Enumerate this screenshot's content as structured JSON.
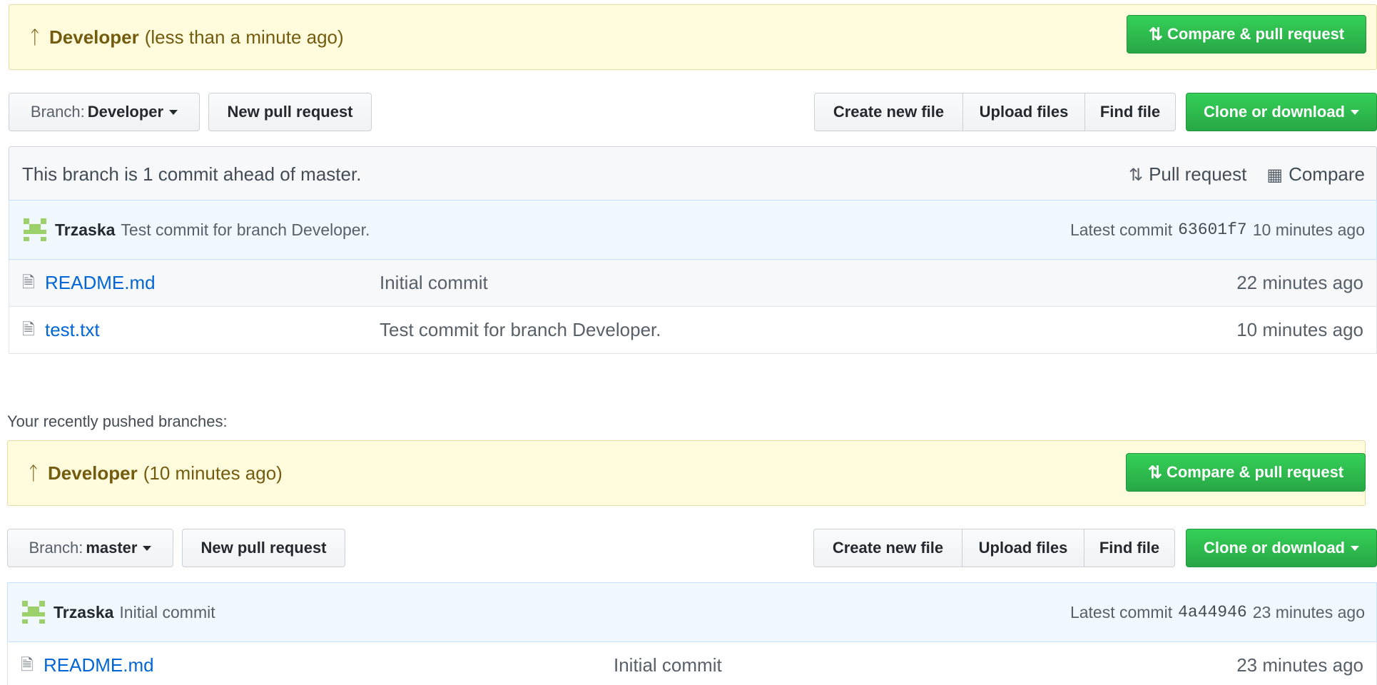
{
  "top": {
    "banner": {
      "branch": "Developer",
      "time": "(less than a minute ago)",
      "compare_button": "Compare & pull request"
    },
    "toolbar": {
      "branch_prefix": "Branch:",
      "branch_name": "Developer",
      "new_pr": "New pull request",
      "create_file": "Create new file",
      "upload_files": "Upload files",
      "find_file": "Find file",
      "clone": "Clone or download"
    },
    "summary": {
      "text": "This branch is 1 commit ahead of master.",
      "pull_request": "Pull request",
      "compare": "Compare"
    },
    "commit": {
      "author": "Trzaska",
      "message": "Test commit for branch Developer.",
      "latest_label": "Latest commit",
      "sha": "63601f7",
      "age": "10 minutes ago"
    },
    "files": [
      {
        "name": "README.md",
        "message": "Initial commit",
        "age": "22 minutes ago"
      },
      {
        "name": "test.txt",
        "message": "Test commit for branch Developer.",
        "age": "10 minutes ago"
      }
    ]
  },
  "recent_label": "Your recently pushed branches:",
  "bottom": {
    "banner": {
      "branch": "Developer",
      "time": "(10 minutes ago)",
      "compare_button": "Compare & pull request"
    },
    "toolbar": {
      "branch_prefix": "Branch:",
      "branch_name": "master",
      "new_pr": "New pull request",
      "create_file": "Create new file",
      "upload_files": "Upload files",
      "find_file": "Find file",
      "clone": "Clone or download"
    },
    "commit": {
      "author": "Trzaska",
      "message": "Initial commit",
      "latest_label": "Latest commit",
      "sha": "4a44946",
      "age": "23 minutes ago"
    },
    "files": [
      {
        "name": "README.md",
        "message": "Initial commit",
        "age": "23 minutes ago"
      }
    ]
  },
  "colors": {
    "banner_bg": "#fffbdd",
    "green": "#28a745",
    "link": "#0366d6",
    "commit_bg": "#f1f8ff"
  }
}
